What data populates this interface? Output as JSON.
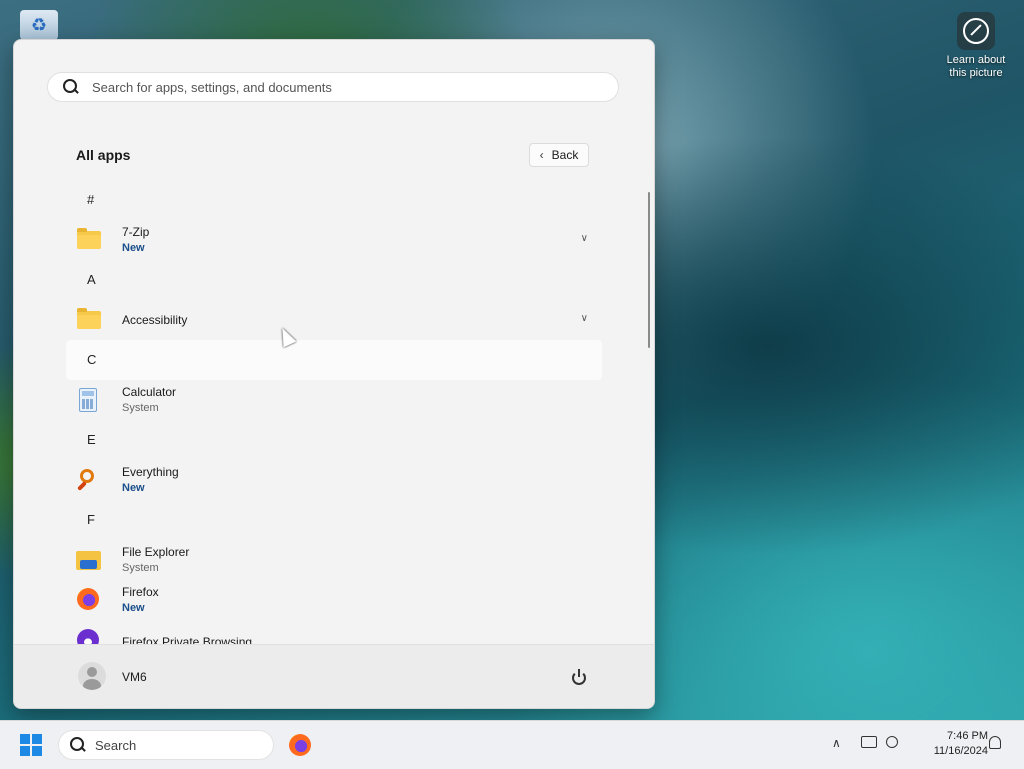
{
  "desktop": {
    "recycle_bin_icon": "recycle-bin-icon",
    "learn_label_line1": "Learn about",
    "learn_label_line2": "this picture"
  },
  "start_menu": {
    "search_placeholder": "Search for apps, settings, and documents",
    "all_apps_title": "All apps",
    "back_label": "Back",
    "groups": [
      {
        "letter": "#",
        "apps": [
          {
            "name": "7-Zip",
            "sub": "New",
            "icon": "folder-icon",
            "expandable": true
          }
        ]
      },
      {
        "letter": "A",
        "apps": [
          {
            "name": "Accessibility",
            "sub": "",
            "icon": "folder-icon",
            "expandable": true
          }
        ]
      },
      {
        "letter": "C",
        "apps": [
          {
            "name": "Calculator",
            "sub": "System",
            "icon": "calculator-icon",
            "expandable": false
          }
        ]
      },
      {
        "letter": "E",
        "apps": [
          {
            "name": "Everything",
            "sub": "New",
            "icon": "everything-search-icon",
            "expandable": false
          }
        ]
      },
      {
        "letter": "F",
        "apps": [
          {
            "name": "File Explorer",
            "sub": "System",
            "icon": "file-explorer-icon",
            "expandable": false
          },
          {
            "name": "Firefox",
            "sub": "New",
            "icon": "firefox-icon",
            "expandable": false
          },
          {
            "name": "Firefox Private Browsing",
            "sub": "",
            "icon": "firefox-private-icon",
            "expandable": false
          }
        ]
      }
    ],
    "user_name": "VM6"
  },
  "taskbar": {
    "search_label": "Search",
    "time": "7:46 PM",
    "date": "11/16/2024"
  },
  "colors": {
    "accent": "#1e88e5",
    "new_badge": "#1a4f8a",
    "menu_bg": "#f3f3f3"
  }
}
